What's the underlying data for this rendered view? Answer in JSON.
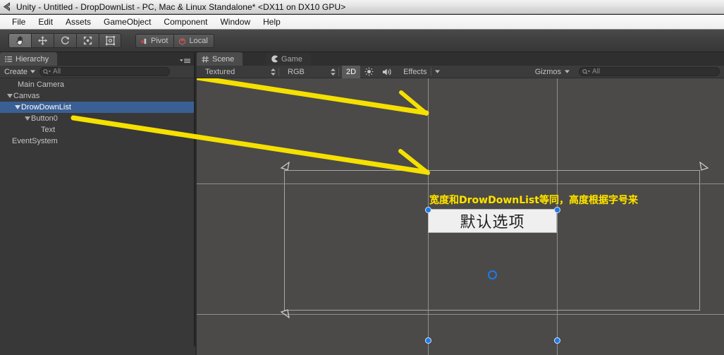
{
  "window": {
    "title": "Unity - Untitled - DropDownList - PC, Mac & Linux Standalone* <DX11 on DX10 GPU>",
    "logo_icon": "unity-logo-icon"
  },
  "menubar": {
    "items": [
      {
        "label": "File"
      },
      {
        "label": "Edit"
      },
      {
        "label": "Assets"
      },
      {
        "label": "GameObject"
      },
      {
        "label": "Component"
      },
      {
        "label": "Window"
      },
      {
        "label": "Help"
      }
    ]
  },
  "toolbar": {
    "transform_tools": [
      {
        "name": "hand-tool",
        "icon": "hand-icon",
        "active": true
      },
      {
        "name": "move-tool",
        "icon": "move-arrows-icon",
        "active": false
      },
      {
        "name": "rotate-tool",
        "icon": "rotate-icon",
        "active": false
      },
      {
        "name": "scale-tool",
        "icon": "scale-icon",
        "active": false
      },
      {
        "name": "rect-tool",
        "icon": "rect-transform-icon",
        "active": false
      }
    ],
    "pivot_label": "Pivot",
    "pivot_icon": "pivot-icon",
    "space_label": "Local",
    "space_icon": "local-space-icon",
    "play_controls": [
      {
        "name": "play-button",
        "icon": "play-icon"
      },
      {
        "name": "pause-button",
        "icon": "pause-icon"
      },
      {
        "name": "step-button",
        "icon": "step-forward-icon"
      }
    ]
  },
  "hierarchy": {
    "tab_label": "Hierarchy",
    "tab_icon": "hierarchy-icon",
    "menu_icon": "panel-menu-icon",
    "create_label": "Create",
    "create_caret_icon": "caret-down-icon",
    "search": {
      "value": "",
      "placeholder": "All",
      "icon": "search-icon"
    },
    "items": [
      {
        "label": "Main Camera",
        "depth": 1,
        "foldout": "none",
        "selected": false
      },
      {
        "label": "Canvas",
        "depth": 0,
        "foldout": "open",
        "selected": false
      },
      {
        "label": "DrowDownList",
        "depth": 1,
        "foldout": "open",
        "selected": true
      },
      {
        "label": "Button0",
        "depth": 2,
        "foldout": "open",
        "selected": false
      },
      {
        "label": "Text",
        "depth": 3,
        "foldout": "none",
        "selected": false
      },
      {
        "label": "EventSystem",
        "depth": 0,
        "foldout": "none",
        "selected": false
      }
    ]
  },
  "scene_panel": {
    "tabs": [
      {
        "label": "Scene",
        "icon": "scene-grid-icon",
        "active": true
      },
      {
        "label": "Game",
        "icon": "game-pacman-icon",
        "active": false
      }
    ],
    "draw_mode": {
      "label": "Textured",
      "icon": "updown-arrows-icon"
    },
    "color_mode": {
      "label": "RGB",
      "icon": "updown-arrows-icon"
    },
    "toggle_2d": {
      "label": "2D",
      "active": true
    },
    "lighting_icon": "sun-icon",
    "audio_icon": "audio-icon",
    "effects": {
      "label": "Effects",
      "caret_icon": "caret-down-icon"
    },
    "gizmos": {
      "label": "Gizmos",
      "caret_icon": "caret-down-icon"
    },
    "search": {
      "value": "",
      "placeholder": "All",
      "icon": "search-icon"
    }
  },
  "viewport": {
    "annotation": "宽度和DrowDownList等同，高度根据字号来",
    "annotation_color": "#ffe400",
    "arrow_color": "#f5e000",
    "selected_button_label": "默认选项",
    "selection_handle_color": "#1e7ae8",
    "canvas_guide_color": "#a7a7a7",
    "background_color": "#4b4a48"
  }
}
